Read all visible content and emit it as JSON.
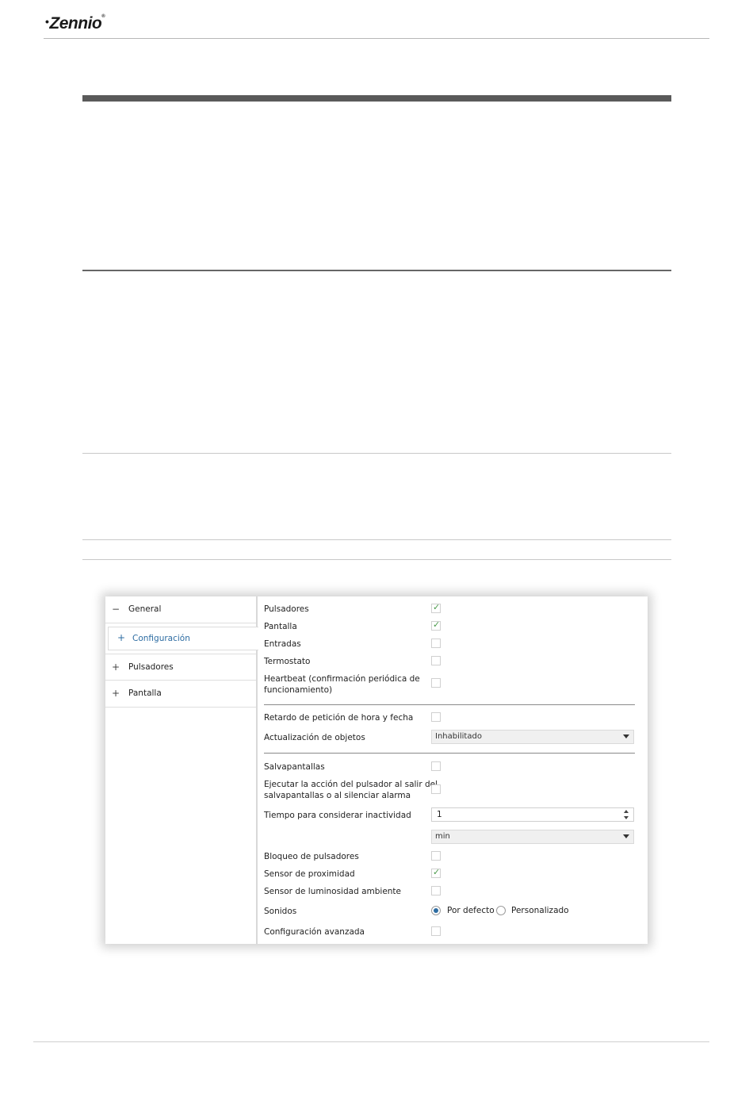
{
  "brand": {
    "name": "Zennio",
    "mark": "•",
    "registered": "®"
  },
  "sidebar": {
    "items": [
      {
        "sign": "−",
        "label": "General"
      },
      {
        "sign": "+",
        "label": "Configuración"
      },
      {
        "sign": "+",
        "label": "Pulsadores"
      },
      {
        "sign": "+",
        "label": "Pantalla"
      }
    ]
  },
  "params": {
    "pulsadores": {
      "label": "Pulsadores",
      "checked": true
    },
    "pantalla": {
      "label": "Pantalla",
      "checked": true
    },
    "entradas": {
      "label": "Entradas",
      "checked": false
    },
    "termostato": {
      "label": "Termostato",
      "checked": false
    },
    "heartbeat": {
      "label_line1": "Heartbeat (confirmación periódica de",
      "label_line2": "funcionamiento)",
      "checked": false
    },
    "retardo": {
      "label": "Retardo de petición de hora y fecha",
      "checked": false
    },
    "actualizacion": {
      "label": "Actualización de objetos",
      "value": "Inhabilitado"
    },
    "salvapantallas": {
      "label": "Salvapantallas",
      "checked": false
    },
    "ejecutar": {
      "label_line1": "Ejecutar la acción del pulsador al salir del",
      "label_line2": "salvapantallas o al silenciar alarma",
      "checked": false
    },
    "tiempo": {
      "label": "Tiempo para considerar inactividad",
      "value": "1",
      "unit": "min"
    },
    "bloqueo": {
      "label": "Bloqueo de pulsadores",
      "checked": false
    },
    "proximidad": {
      "label": "Sensor de proximidad",
      "checked": true
    },
    "luminosidad": {
      "label": "Sensor de luminosidad ambiente",
      "checked": false
    },
    "sonidos": {
      "label": "Sonidos",
      "options": [
        "Por defecto",
        "Personalizado"
      ],
      "selected": "Por defecto"
    },
    "avanzada": {
      "label": "Configuración avanzada",
      "checked": false
    }
  },
  "icons": {
    "check": "check-icon",
    "dropdown": "chevron-down-icon"
  },
  "colors": {
    "accent": "#2d6ca2",
    "check": "#4a9a4a"
  }
}
